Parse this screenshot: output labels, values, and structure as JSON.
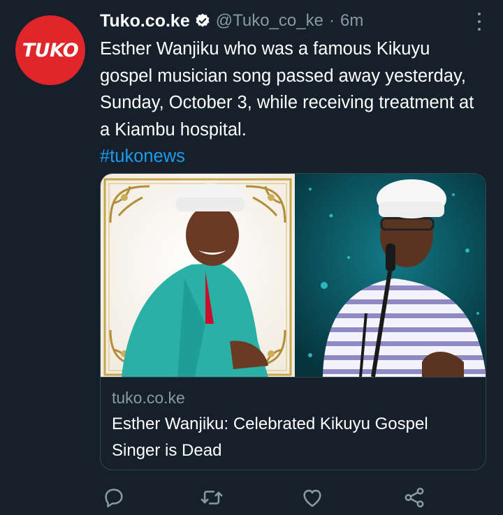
{
  "tweet": {
    "avatar_text": "TUKO",
    "display_name": "Tuko.co.ke",
    "handle": "@Tuko_co_ke",
    "separator": "·",
    "time": "6m",
    "text": "Esther Wanjiku who was a famous Kikuyu gospel musician song passed away yesterday, Sunday, October 3, while receiving treatment at a Kiambu hospital.",
    "hashtag": "#tukonews",
    "card": {
      "domain": "tuko.co.ke",
      "title": "Esther Wanjiku: Celebrated Kikuyu Gospel Singer is Dead"
    },
    "actions": [
      "reply-icon",
      "retweet-icon",
      "like-icon",
      "share-icon"
    ]
  },
  "colors": {
    "background": "#15202b",
    "text": "#ffffff",
    "muted": "#8b98a5",
    "link": "#1d9bf0",
    "brand_red": "#e0252b",
    "border": "#38444d"
  }
}
